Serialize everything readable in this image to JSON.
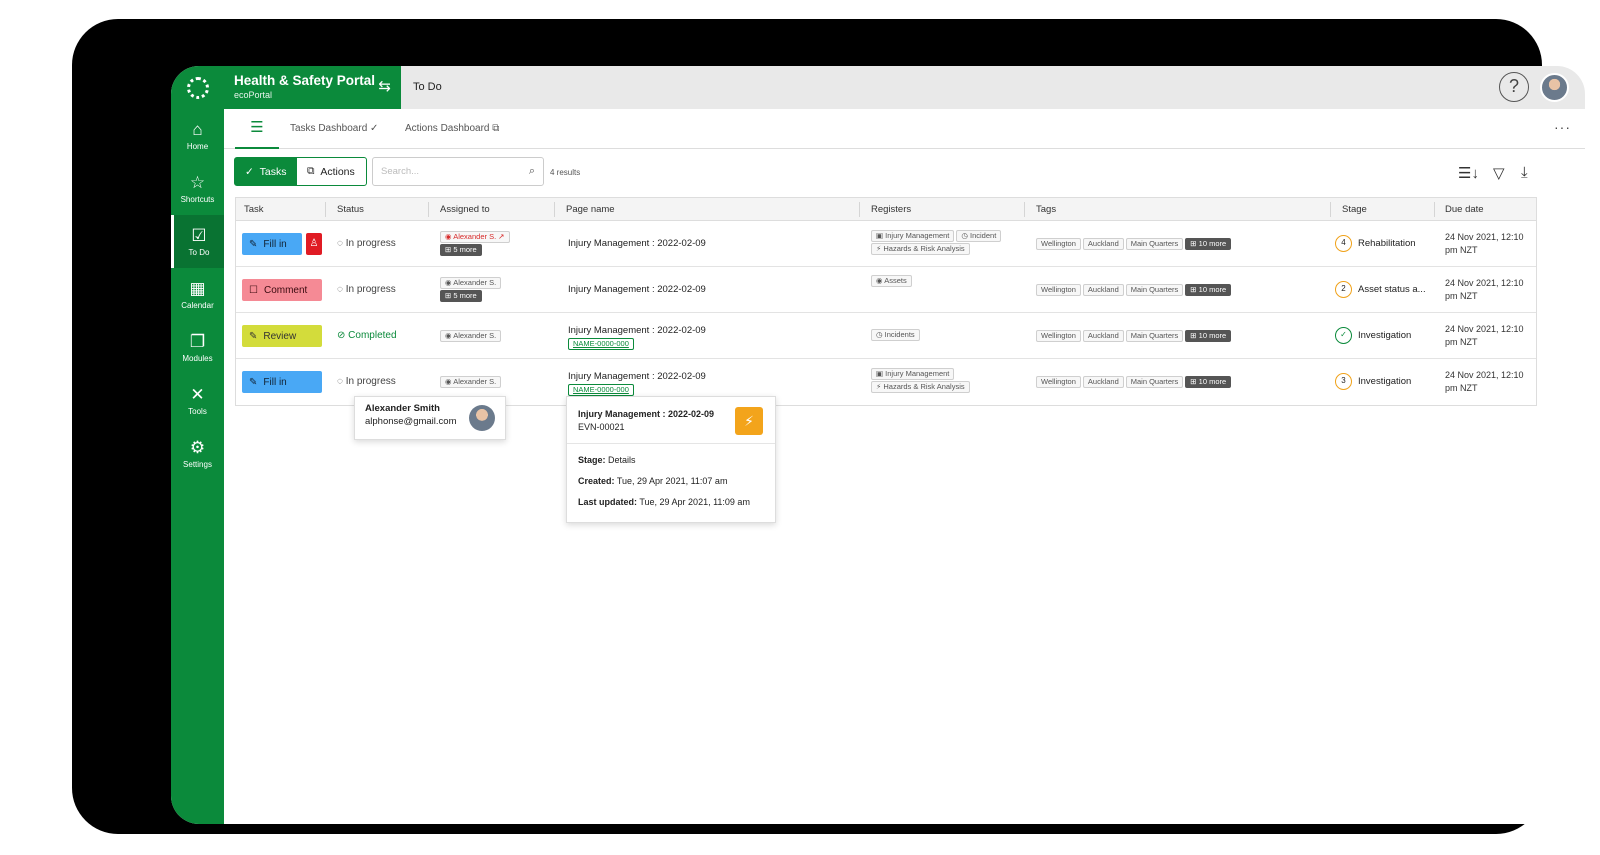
{
  "app": {
    "title": "Health & Safety Portal",
    "subtitle": "ecoPortal",
    "breadcrumb": "To Do",
    "help": "?"
  },
  "sidebar": {
    "items": [
      {
        "label": "Home",
        "icon": "⌂"
      },
      {
        "label": "Shortcuts",
        "icon": "☆"
      },
      {
        "label": "To Do",
        "icon": "☑"
      },
      {
        "label": "Calendar",
        "icon": "▦"
      },
      {
        "label": "Modules",
        "icon": "❐"
      },
      {
        "label": "Tools",
        "icon": "✕"
      },
      {
        "label": "Settings",
        "icon": "⚙"
      }
    ]
  },
  "tabs": {
    "list_icon": "☰",
    "tasks_dashboard": "Tasks Dashboard",
    "actions_dashboard": "Actions Dashboard",
    "more": "···"
  },
  "toolbar": {
    "tasks": "Tasks",
    "actions": "Actions",
    "search_placeholder": "Search...",
    "results": "4 results"
  },
  "table": {
    "headers": {
      "task": "Task",
      "status": "Status",
      "assigned": "Assigned to",
      "page": "Page name",
      "registers": "Registers",
      "tags": "Tags",
      "stage": "Stage",
      "due": "Due date"
    },
    "rows": [
      {
        "task": "Fill in",
        "status": "In progress",
        "assignee": "Alexander S.",
        "more": "5 more",
        "page": "Injury Management : 2022-02-09",
        "code": "",
        "registers": [
          "Injury Management",
          "Incident",
          "Hazards & Risk Analysis"
        ],
        "tags": [
          "Wellington",
          "Auckland",
          "Main Quarters",
          "10 more"
        ],
        "stage_num": "4",
        "stage": "Rehabilitation",
        "due1": "24 Nov 2021, 12:10",
        "due2": "pm NZT"
      },
      {
        "task": "Comment",
        "status": "In progress",
        "assignee": "Alexander S.",
        "more": "5 more",
        "page": "Injury Management : 2022-02-09",
        "code": "",
        "registers": [
          "Assets"
        ],
        "tags": [
          "Wellington",
          "Auckland",
          "Main Quarters",
          "10 more"
        ],
        "stage_num": "2",
        "stage": "Asset status a...",
        "due1": "24 Nov 2021, 12:10",
        "due2": "pm NZT"
      },
      {
        "task": "Review",
        "status": "Completed",
        "assignee": "Alexander S.",
        "more": "",
        "page": "Injury Management : 2022-02-09",
        "code": "NAME-0000-000",
        "registers": [
          "Incidents"
        ],
        "tags": [
          "Wellington",
          "Auckland",
          "Main Quarters",
          "10 more"
        ],
        "stage_num": "✓",
        "stage": "Investigation",
        "due1": "24 Nov 2021, 12:10",
        "due2": "pm NZT"
      },
      {
        "task": "Fill in",
        "status": "In progress",
        "assignee": "Alexander S.",
        "more": "",
        "page": "Injury Management : 2022-02-09",
        "code": "NAME-0000-000",
        "registers": [
          "Injury Management",
          "Hazards & Risk Analysis"
        ],
        "tags": [
          "Wellington",
          "Auckland",
          "Main Quarters",
          "10 more"
        ],
        "stage_num": "3",
        "stage": "Investigation",
        "due1": "24 Nov 2021, 12:10",
        "due2": "pm NZT"
      }
    ]
  },
  "user_popover": {
    "name": "Alexander Smith",
    "email": "alphonse@gmail.com"
  },
  "page_popover": {
    "title": "Injury Management : 2022-02-09",
    "code": "EVN-00021",
    "stage_label": "Stage:",
    "stage": "Details",
    "created_label": "Created:",
    "created": "Tue, 29 Apr 2021, 11:07 am",
    "updated_label": "Last updated:",
    "updated": "Tue, 29 Apr 2021, 11:09 am"
  },
  "colors": {
    "brand": "#0b8a3b",
    "fill": "#49a8f5",
    "comment": "#f58a95",
    "review": "#d3dc3b",
    "stage_ring": "#f0a21a",
    "badge": "#f3a41b"
  }
}
